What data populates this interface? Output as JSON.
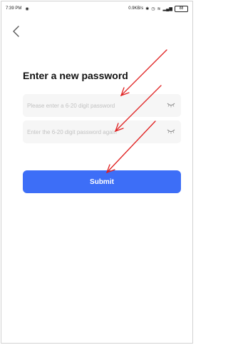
{
  "status_bar": {
    "time": "7:39 PM",
    "network_speed": "0.9KB/s",
    "battery": "88"
  },
  "page": {
    "title": "Enter a new password"
  },
  "form": {
    "password_placeholder": "Please enter a 6-20 digit password",
    "confirm_placeholder": "Enter the 6-20 digit password again",
    "submit_label": "Submit"
  },
  "colors": {
    "accent": "#3d6ef7",
    "annotation": "#e02020",
    "field_bg": "#f6f6f6"
  },
  "icons": [
    "back-icon",
    "eye-hidden-icon"
  ]
}
